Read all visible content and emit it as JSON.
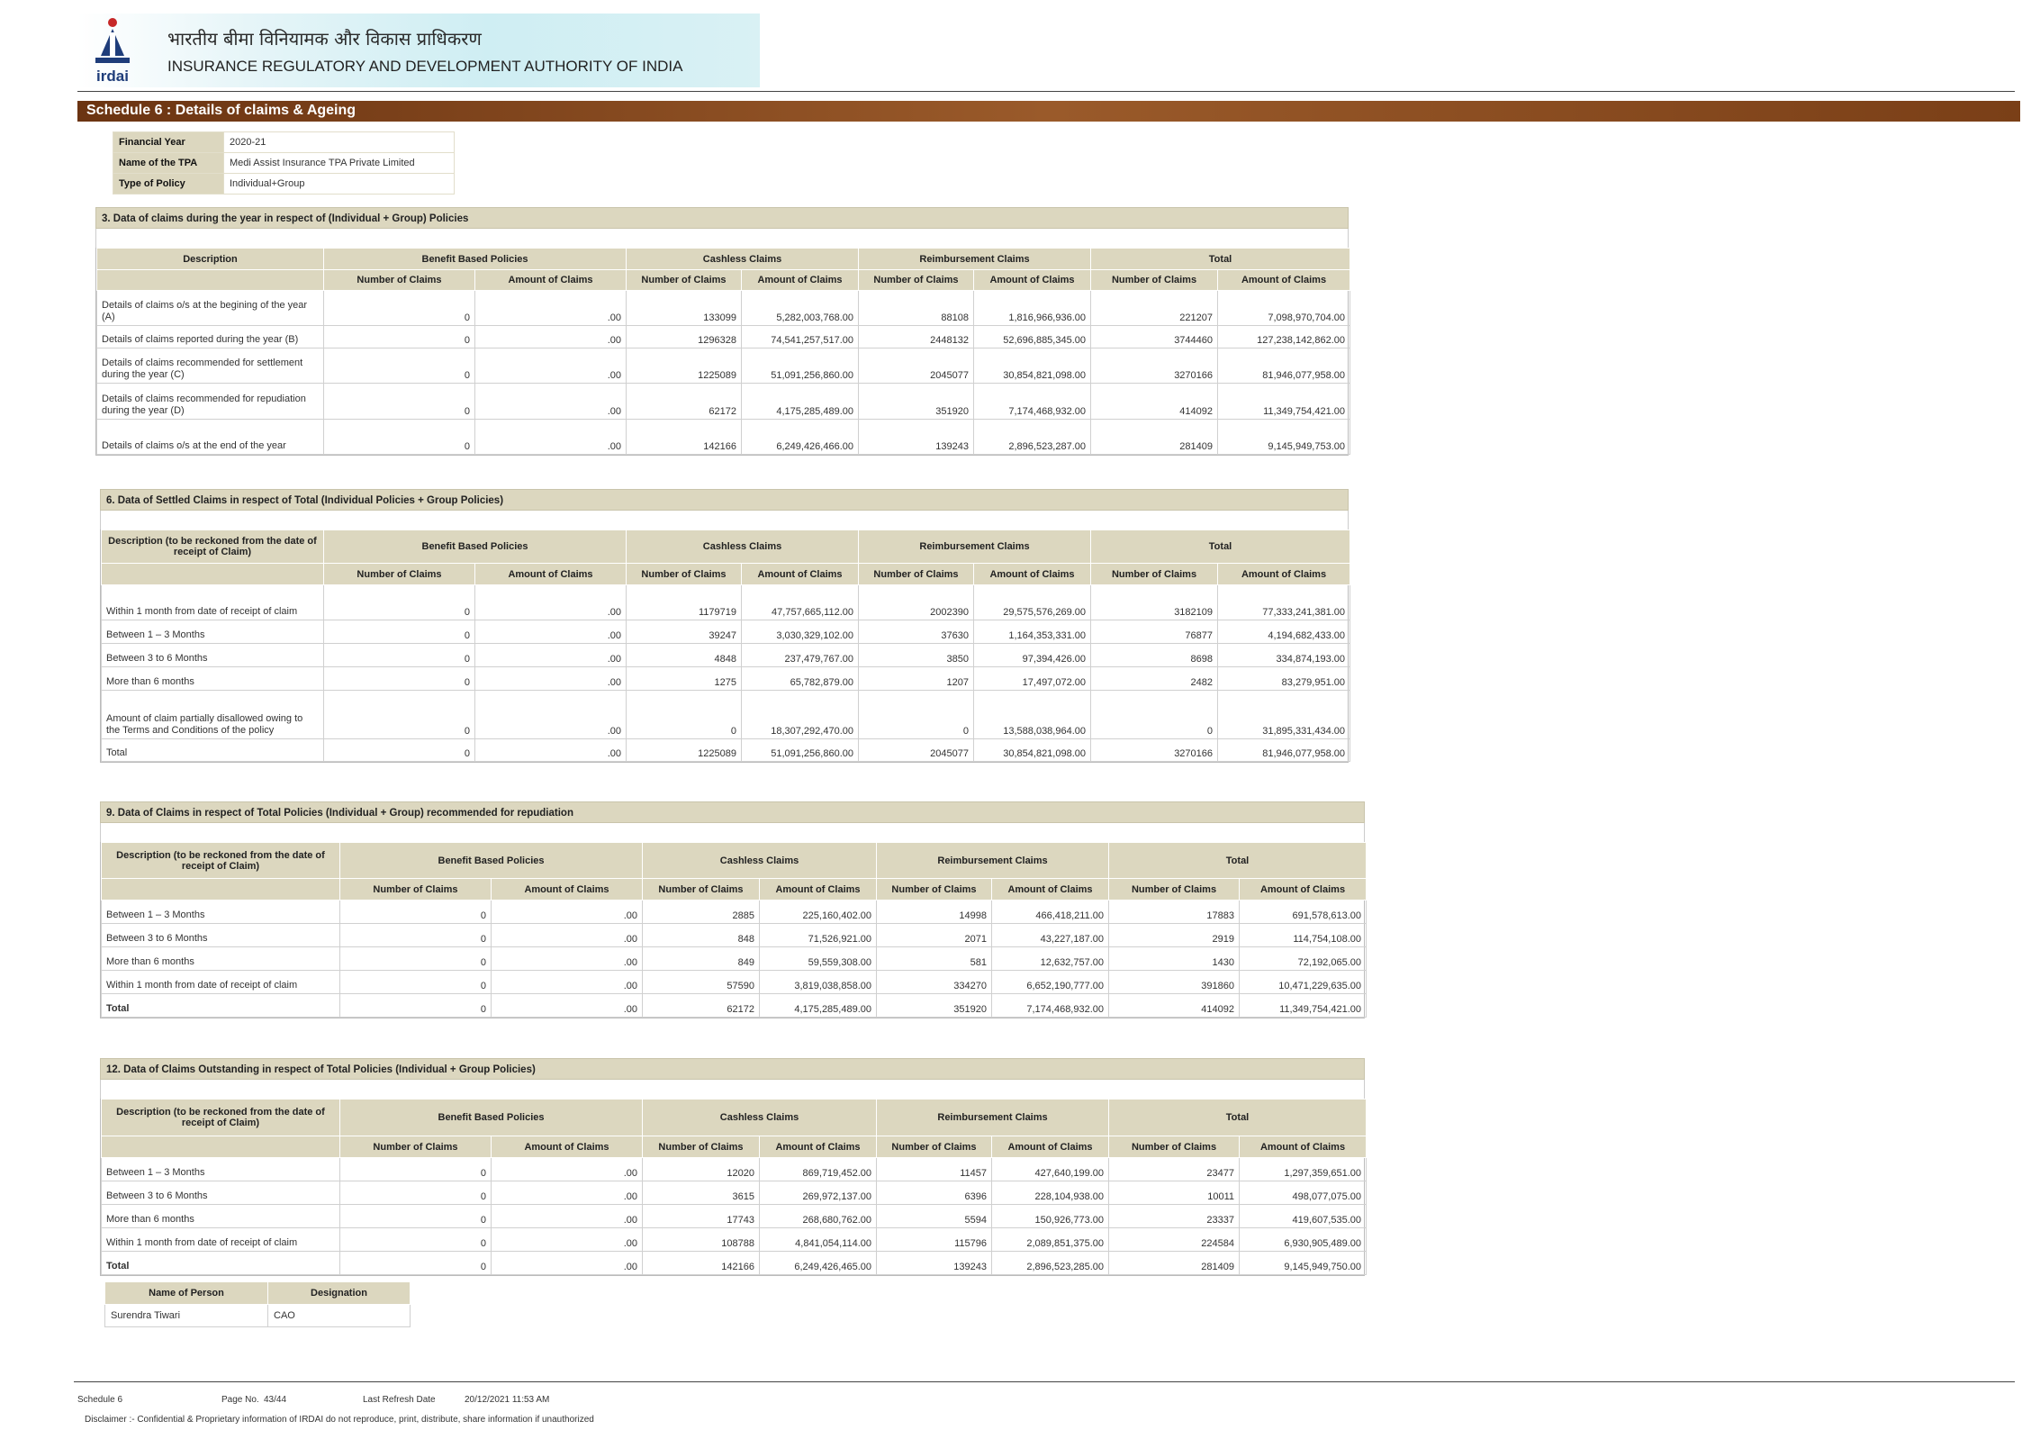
{
  "header": {
    "logo_text": "irdai",
    "hindi_name": "भारतीय बीमा विनियामक और विकास प्राधिकरण",
    "english_name": "INSURANCE REGULATORY AND DEVELOPMENT AUTHORITY OF INDIA"
  },
  "schedule_title": "Schedule 6 : Details of claims & Ageing",
  "info": [
    {
      "label": "Financial Year",
      "value": "2020-21"
    },
    {
      "label": "Name of the TPA",
      "value": "Medi Assist Insurance TPA Private Limited"
    },
    {
      "label": "Type of Policy",
      "value": "Individual+Group"
    }
  ],
  "col_groups": [
    "Benefit Based Policies",
    "Cashless Claims",
    "Reimbursement Claims",
    "Total"
  ],
  "sub_cols": [
    "Number of Claims",
    "Amount of Claims"
  ],
  "sections": [
    {
      "title": "3. Data of claims during the year in respect of (Individual + Group) Policies",
      "desc_header": "Description",
      "rows": [
        {
          "label": "Details of claims o/s at the begining of the year (A)",
          "values": [
            "0",
            ".00",
            "133099",
            "5,282,003,768.00",
            "88108",
            "1,816,966,936.00",
            "221207",
            "7,098,970,704.00"
          ]
        },
        {
          "label": "Details of claims reported during the year (B)",
          "values": [
            "0",
            ".00",
            "1296328",
            "74,541,257,517.00",
            "2448132",
            "52,696,885,345.00",
            "3744460",
            "127,238,142,862.00"
          ]
        },
        {
          "label": "Details of claims recommended for settlement during the year (C)",
          "values": [
            "0",
            ".00",
            "1225089",
            "51,091,256,860.00",
            "2045077",
            "30,854,821,098.00",
            "3270166",
            "81,946,077,958.00"
          ]
        },
        {
          "label": "Details of claims recommended for repudiation during the year (D)",
          "values": [
            "0",
            ".00",
            "62172",
            "4,175,285,489.00",
            "351920",
            "7,174,468,932.00",
            "414092",
            "11,349,754,421.00"
          ]
        },
        {
          "label": "Details of claims o/s at the end of the year",
          "values": [
            "0",
            ".00",
            "142166",
            "6,249,426,466.00",
            "139243",
            "2,896,523,287.00",
            "281409",
            "9,145,949,753.00"
          ]
        }
      ]
    },
    {
      "title": "6. Data of Settled Claims in respect of Total (Individual Policies + Group Policies)",
      "desc_header": "Description (to be reckoned from the date of receipt of Claim)",
      "rows": [
        {
          "label": "Within 1 month from date of receipt of claim",
          "values": [
            "0",
            ".00",
            "1179719",
            "47,757,665,112.00",
            "2002390",
            "29,575,576,269.00",
            "3182109",
            "77,333,241,381.00"
          ]
        },
        {
          "label": "Between 1 – 3 Months",
          "values": [
            "0",
            ".00",
            "39247",
            "3,030,329,102.00",
            "37630",
            "1,164,353,331.00",
            "76877",
            "4,194,682,433.00"
          ]
        },
        {
          "label": "Between 3 to 6 Months",
          "values": [
            "0",
            ".00",
            "4848",
            "237,479,767.00",
            "3850",
            "97,394,426.00",
            "8698",
            "334,874,193.00"
          ]
        },
        {
          "label": "More than 6 months",
          "values": [
            "0",
            ".00",
            "1275",
            "65,782,879.00",
            "1207",
            "17,497,072.00",
            "2482",
            "83,279,951.00"
          ]
        },
        {
          "label": "Amount of claim partially disallowed owing to the Terms and Conditions of the policy",
          "values": [
            "0",
            ".00",
            "0",
            "18,307,292,470.00",
            "0",
            "13,588,038,964.00",
            "0",
            "31,895,331,434.00"
          ]
        },
        {
          "label": "Total",
          "values": [
            "0",
            ".00",
            "1225089",
            "51,091,256,860.00",
            "2045077",
            "30,854,821,098.00",
            "3270166",
            "81,946,077,958.00"
          ]
        }
      ]
    },
    {
      "title": "9. Data of Claims in respect of Total Policies (Individual + Group) recommended for repudiation",
      "desc_header": "Description  (to be reckoned from the date of receipt of Claim)",
      "rows": [
        {
          "label": "Between 1 – 3 Months",
          "values": [
            "0",
            ".00",
            "2885",
            "225,160,402.00",
            "14998",
            "466,418,211.00",
            "17883",
            "691,578,613.00"
          ]
        },
        {
          "label": "Between 3 to 6 Months",
          "values": [
            "0",
            ".00",
            "848",
            "71,526,921.00",
            "2071",
            "43,227,187.00",
            "2919",
            "114,754,108.00"
          ]
        },
        {
          "label": "More than 6 months",
          "values": [
            "0",
            ".00",
            "849",
            "59,559,308.00",
            "581",
            "12,632,757.00",
            "1430",
            "72,192,065.00"
          ]
        },
        {
          "label": "Within 1 month from date of receipt of claim",
          "values": [
            "0",
            ".00",
            "57590",
            "3,819,038,858.00",
            "334270",
            "6,652,190,777.00",
            "391860",
            "10,471,229,635.00"
          ]
        },
        {
          "label": "Total",
          "bold": true,
          "values": [
            "0",
            ".00",
            "62172",
            "4,175,285,489.00",
            "351920",
            "7,174,468,932.00",
            "414092",
            "11,349,754,421.00"
          ]
        }
      ]
    },
    {
      "title": "12. Data of Claims Outstanding in respect of Total Policies (Individual + Group Policies)",
      "desc_header": "Description (to be reckoned from the date of receipt of Claim)",
      "rows": [
        {
          "label": "Between 1 – 3 Months",
          "values": [
            "0",
            ".00",
            "12020",
            "869,719,452.00",
            "11457",
            "427,640,199.00",
            "23477",
            "1,297,359,651.00"
          ]
        },
        {
          "label": "Between 3 to 6 Months",
          "values": [
            "0",
            ".00",
            "3615",
            "269,972,137.00",
            "6396",
            "228,104,938.00",
            "10011",
            "498,077,075.00"
          ]
        },
        {
          "label": "More than 6 months",
          "values": [
            "0",
            ".00",
            "17743",
            "268,680,762.00",
            "5594",
            "150,926,773.00",
            "23337",
            "419,607,535.00"
          ]
        },
        {
          "label": "Within 1 month from date of receipt of claim",
          "values": [
            "0",
            ".00",
            "108788",
            "4,841,054,114.00",
            "115796",
            "2,089,851,375.00",
            "224584",
            "6,930,905,489.00"
          ]
        },
        {
          "label": "Total",
          "bold": true,
          "values": [
            "0",
            ".00",
            "142166",
            "6,249,426,465.00",
            "139243",
            "2,896,523,285.00",
            "281409",
            "9,145,949,750.00"
          ]
        }
      ]
    }
  ],
  "signatory": {
    "headers": [
      "Name of Person",
      "Designation"
    ],
    "name": "Surendra Tiwari",
    "designation": "CAO"
  },
  "footer": {
    "schedule": "Schedule 6",
    "page_label": "Page No.",
    "page_value": "43/44",
    "refresh_label": "Last Refresh Date",
    "refresh_value": "20/12/2021 11:53 AM",
    "disclaimer": "Disclaimer :- Confidential & Proprietary information of IRDAI do not reproduce, print, distribute, share information if unauthorized"
  }
}
